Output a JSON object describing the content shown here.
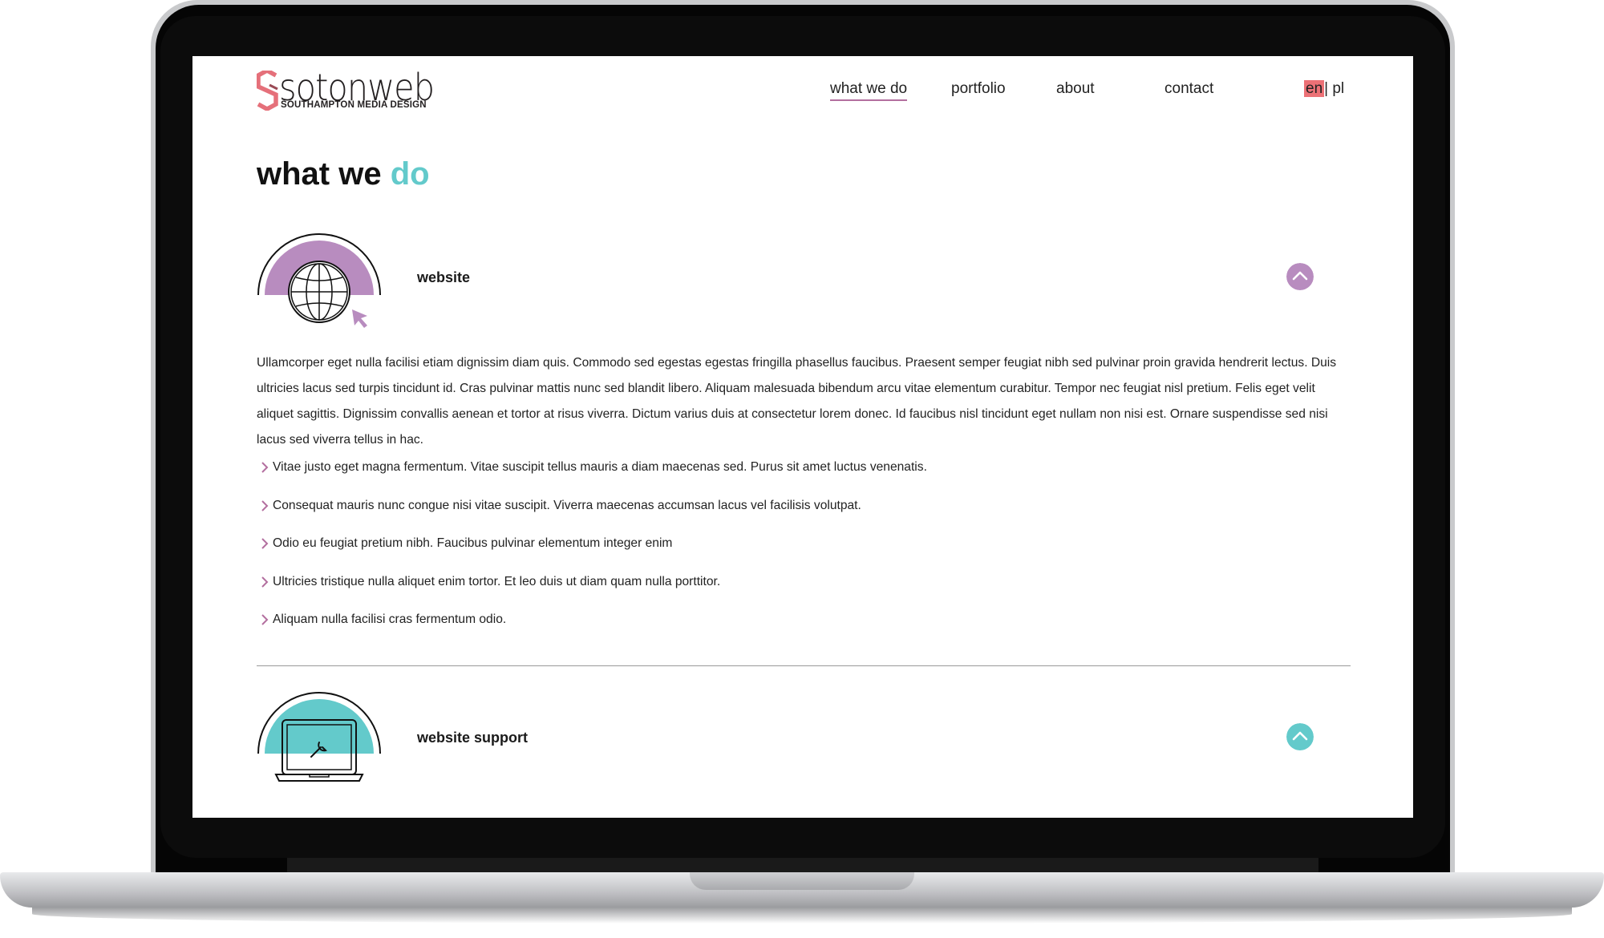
{
  "brand": {
    "name": "sotonweb",
    "tagline": "SOUTHAMPTON MEDIA DESIGN",
    "logo_color": "#e5707a"
  },
  "nav": {
    "items": [
      "what we do",
      "portfolio",
      "about",
      "contact"
    ],
    "active": "what we do",
    "lang_en": "en",
    "lang_sep": "|",
    "lang_pl": "pl"
  },
  "page": {
    "title_main": "what we ",
    "title_accent": "do"
  },
  "colors": {
    "purple": "#b88cbf",
    "teal": "#63cacb",
    "pink": "#ec7176"
  },
  "sections": [
    {
      "heading": "website",
      "icon": "globe-icon",
      "toggle_icon": "chevron-up-icon",
      "paragraph": "Ullamcorper eget nulla facilisi etiam dignissim diam quis. Commodo sed egestas egestas fringilla phasellus faucibus. Praesent semper feugiat nibh sed pulvinar proin gravida hendrerit lectus. Duis ultricies lacus sed turpis tincidunt id. Cras pulvinar mattis nunc sed blandit libero. Aliquam malesuada bibendum arcu vitae elementum curabitur. Tempor nec feugiat nisl pretium. Felis eget velit aliquet sagittis. Dignissim convallis aenean et tortor at risus viverra. Dictum varius duis at consectetur lorem donec. Id faucibus nisl tincidunt eget nullam non nisi est. Ornare suspendisse sed nisi lacus sed viverra tellus in hac.",
      "bullets": [
        "Vitae justo eget magna fermentum. Vitae suscipit tellus mauris a diam maecenas sed. Purus sit amet luctus venenatis.",
        "Consequat mauris nunc congue nisi vitae suscipit. Viverra maecenas accumsan lacus vel facilisis volutpat.",
        "Odio eu feugiat pretium nibh. Faucibus pulvinar elementum integer enim",
        "Ultricies tristique nulla aliquet enim tortor. Et leo duis ut diam quam nulla porttitor.",
        "Aliquam nulla facilisi cras fermentum odio."
      ]
    },
    {
      "heading": "website support",
      "icon": "laptop-wrench-icon",
      "toggle_icon": "chevron-up-icon"
    }
  ]
}
